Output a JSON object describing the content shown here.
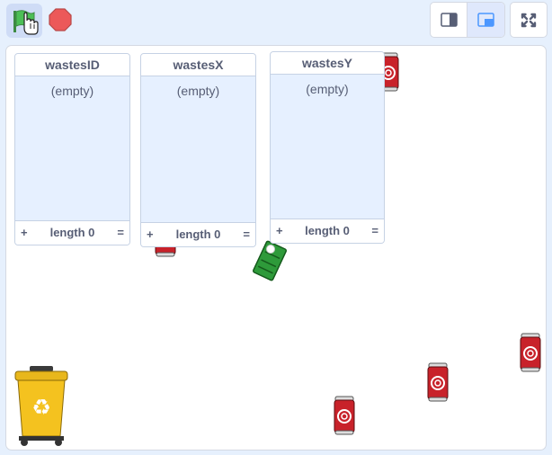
{
  "toolbar": {
    "green_flag_icon": "green-flag-icon",
    "stop_icon": "stop-icon",
    "flag_color": "#4cbf56",
    "stop_color": "#ec5959"
  },
  "monitors": [
    {
      "title": "wastesID",
      "empty_label": "(empty)",
      "add": "+",
      "length_label": "length 0",
      "resize": "="
    },
    {
      "title": "wastesX",
      "empty_label": "(empty)",
      "add": "+",
      "length_label": "length 0",
      "resize": "="
    },
    {
      "title": "wastesY",
      "empty_label": "(empty)",
      "add": "+",
      "length_label": "length 0",
      "resize": "="
    }
  ],
  "sprites": {
    "can": "soda-can",
    "bin": "recycle-bin",
    "bin_symbol": "♻",
    "robot": "green-robot"
  }
}
